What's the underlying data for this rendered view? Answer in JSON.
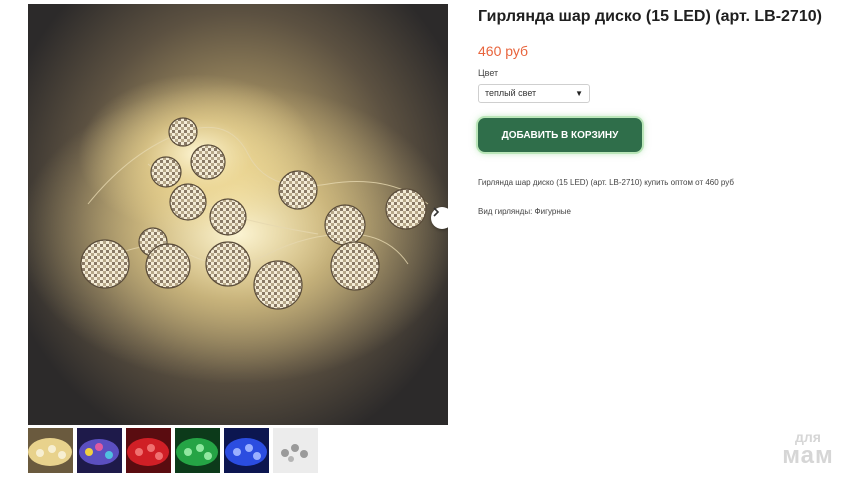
{
  "product": {
    "title": "Гирлянда шар диско (15 LED) (арт. LB-2710)",
    "price": "460 руб",
    "option_label": "Цвет",
    "option_selected": "теплый свет",
    "add_to_cart_label": "ДОБАВИТЬ В КОРЗИНУ",
    "description": "Гирлянда шар диско (15 LED) (арт. LB-2710) купить оптом от 460 руб",
    "garland_type": "Вид гирлянды: Фигурные"
  },
  "gallery": {
    "next_icon": "chevron-right-icon",
    "thumbnails": [
      {
        "name": "warm",
        "color": "#d8c27c"
      },
      {
        "name": "multicolor",
        "color": "#7a55c9"
      },
      {
        "name": "red",
        "color": "#d8242c"
      },
      {
        "name": "green",
        "color": "#27a548"
      },
      {
        "name": "blue",
        "color": "#2d4fe0"
      },
      {
        "name": "silver",
        "color": "#c9c9c9"
      }
    ]
  },
  "watermark": {
    "line1": "для",
    "line2": "мам"
  },
  "colors": {
    "price": "#e8643c",
    "button": "#2f6e4a",
    "button_glow": "#b9e6b8"
  }
}
